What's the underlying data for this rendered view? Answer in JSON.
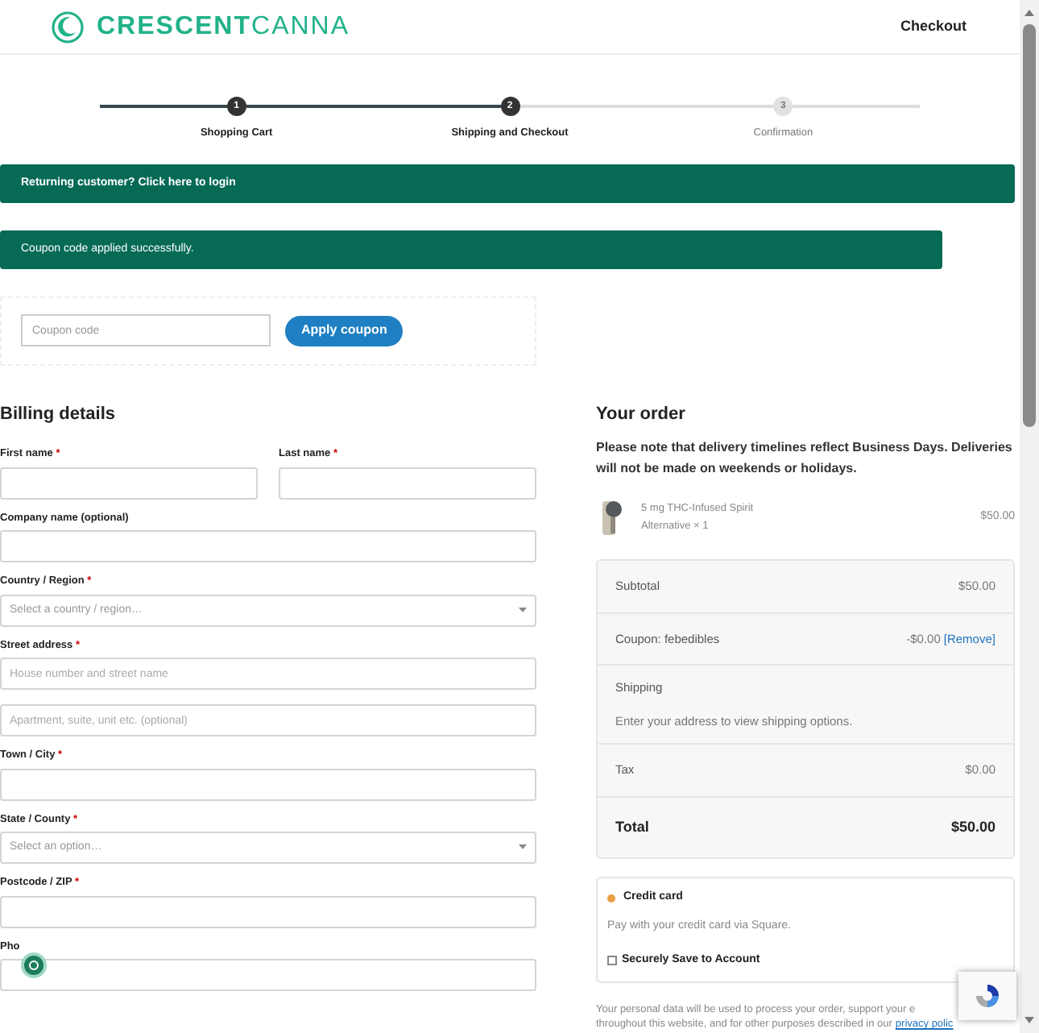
{
  "header": {
    "logo_bold": "CRESCENT",
    "logo_light": "CANNA",
    "nav_link": "Checkout"
  },
  "steps": [
    {
      "number": "1",
      "label": "Shopping Cart",
      "active": true
    },
    {
      "number": "2",
      "label": "Shipping and Checkout",
      "active": true
    },
    {
      "number": "3",
      "label": "Confirmation",
      "active": false
    }
  ],
  "notices": [
    {
      "text": "Returning customer? Click here to login",
      "kind": "link"
    },
    {
      "text": "Coupon code applied successfully.",
      "kind": "message"
    }
  ],
  "coupon": {
    "placeholder": "Coupon code",
    "button": "Apply coupon"
  },
  "billing": {
    "title": "Billing details",
    "name_row": [
      {
        "label": "First name",
        "required_mark": "*",
        "kind": "text"
      },
      {
        "label": "Last name",
        "required_mark": "*",
        "kind": "text"
      }
    ],
    "fields": [
      {
        "label": "Company name (optional)",
        "kind": "text"
      },
      {
        "label": "Country / Region",
        "required_mark": "*",
        "kind": "select",
        "placeholder": "Select a country / region…"
      },
      {
        "label": "Street address",
        "required_mark": "*",
        "kind": "text",
        "placeholder": "House number and street name"
      },
      {
        "kind": "text",
        "placeholder": "Apartment, suite, unit etc. (optional)"
      },
      {
        "label": "Town / City",
        "required_mark": "*",
        "kind": "text"
      },
      {
        "label": "State / County",
        "required_mark": "*",
        "kind": "select",
        "placeholder": "Select an option…"
      },
      {
        "label": "Postcode / ZIP",
        "required_mark": "*",
        "kind": "text"
      },
      {
        "label": "Pho",
        "kind": "text"
      }
    ]
  },
  "order": {
    "title": "Your order",
    "note": "Please note that delivery timelines reflect Business Days. Deliveries will not be made on weekends or holidays.",
    "item": {
      "name": "5 mg THC-Infused Spirit",
      "variant": "Alternative × 1",
      "price": "$50.00"
    },
    "totals": [
      {
        "kind": "line",
        "label": "Subtotal",
        "value": "$50.00"
      },
      {
        "kind": "coupon",
        "label": "Coupon: febedibles",
        "value": "-$0.00",
        "link": "[Remove]"
      },
      {
        "kind": "shipping",
        "label": "Shipping",
        "value": "Enter your address to view shipping options."
      },
      {
        "kind": "line",
        "label": "Tax",
        "value": "$0.00"
      },
      {
        "kind": "total",
        "label": "Total",
        "value": "$50.00"
      }
    ],
    "payment": {
      "method": "Credit card",
      "selected": true,
      "description": "Pay with your credit card via Square.",
      "save_label": "Securely Save to Account",
      "save_checked": false
    },
    "privacy": {
      "line1": "Your personal data will be used to process your order, support your e",
      "line2": "throughout this website, and for other purposes described in our",
      "link": "privacy polic"
    }
  }
}
